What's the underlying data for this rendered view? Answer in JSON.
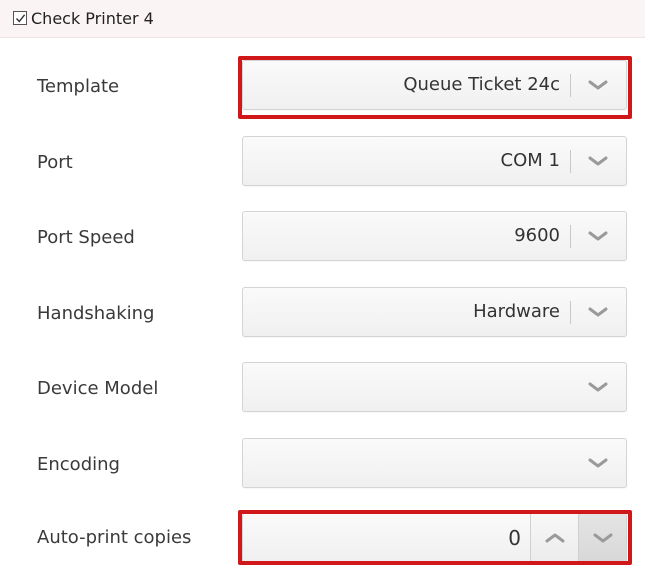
{
  "section": {
    "title": "Check Printer 4",
    "checked": true
  },
  "rows": [
    {
      "label": "Template",
      "value": "Queue Ticket 24c"
    },
    {
      "label": "Port",
      "value": "COM 1"
    },
    {
      "label": "Port Speed",
      "value": "9600"
    },
    {
      "label": "Handshaking",
      "value": "Hardware"
    },
    {
      "label": "Device Model",
      "value": ""
    },
    {
      "label": "Encoding",
      "value": ""
    }
  ],
  "copies": {
    "label": "Auto-print copies",
    "value": "0"
  },
  "icons": {
    "dropdown": "chevron-down-icon",
    "increment": "chevron-up-icon",
    "decrement": "chevron-down-icon",
    "checkbox": "checkmark-icon"
  },
  "colors": {
    "highlight": "#d0181b",
    "header_bg": "#fbf4f4"
  }
}
